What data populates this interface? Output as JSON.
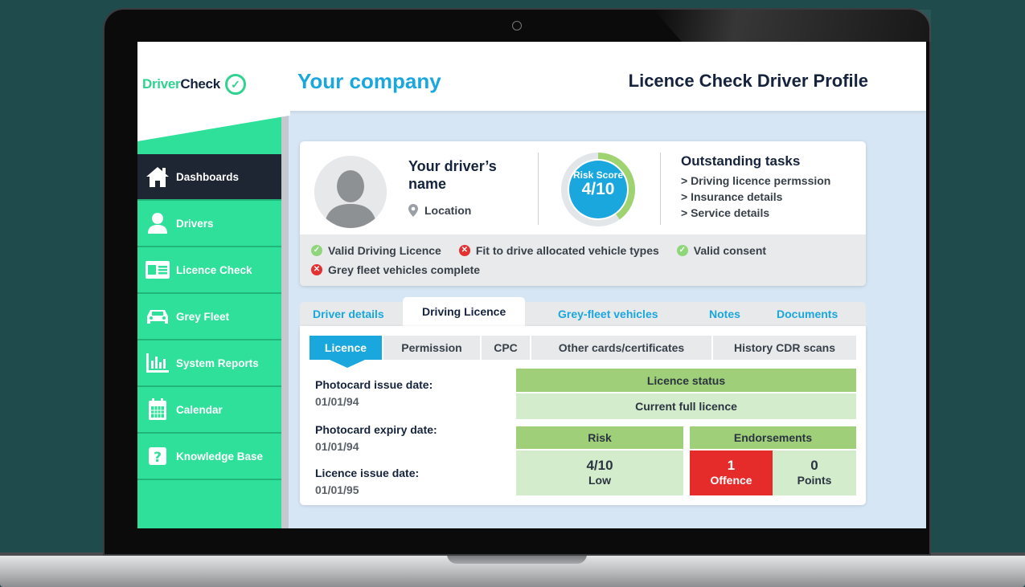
{
  "brand": {
    "logo_part1": "Driver",
    "logo_part2": "Check",
    "company": "Your company",
    "page_title": "Licence Check Driver Profile"
  },
  "sidebar": {
    "items": [
      {
        "label": "Dashboards",
        "icon": "home-icon",
        "active": true
      },
      {
        "label": "Drivers",
        "icon": "person-icon",
        "active": false
      },
      {
        "label": "Licence Check",
        "icon": "id-card-icon",
        "active": false
      },
      {
        "label": "Grey Fleet",
        "icon": "car-icon",
        "active": false
      },
      {
        "label": "System Reports",
        "icon": "bar-chart-icon",
        "active": false
      },
      {
        "label": "Calendar",
        "icon": "calendar-icon",
        "active": false
      },
      {
        "label": "Knowledge Base",
        "icon": "question-icon",
        "active": false
      }
    ]
  },
  "profile": {
    "driver_name": "Your driver’s name",
    "location": "Location",
    "risk_label": "Risk Score",
    "risk_score": "4/10",
    "risk_fraction": 0.4,
    "tasks_title": "Outstanding tasks",
    "tasks": [
      "> Driving licence permssion",
      "> Insurance details",
      "> Service details"
    ],
    "status": [
      {
        "label": "Valid Driving Licence",
        "ok": true
      },
      {
        "label": "Fit to drive allocated vehicle types",
        "ok": false
      },
      {
        "label": "Valid consent",
        "ok": true
      },
      {
        "label": "Grey fleet vehicles complete",
        "ok": false
      }
    ]
  },
  "tabs": {
    "items": [
      "Driver details",
      "Driving Licence",
      "Grey-fleet vehicles",
      "Notes",
      "Documents"
    ],
    "active": "Driving Licence"
  },
  "subtabs": {
    "items": [
      "Licence",
      "Permission",
      "CPC",
      "Other cards/certificates",
      "History CDR scans"
    ],
    "active": "Licence"
  },
  "licence": {
    "fields": [
      {
        "label": "Photocard issue date:",
        "value": "01/01/94"
      },
      {
        "label": "Photocard expiry date:",
        "value": "01/01/94"
      },
      {
        "label": "Licence issue date:",
        "value": "01/01/95"
      }
    ],
    "status_header": "Licence status",
    "status_value": "Current full licence",
    "risk_header": "Risk",
    "risk_value": "4/10",
    "risk_level": "Low",
    "endorsements_header": "Endorsements",
    "offence_count": "1",
    "offence_label": "Offence",
    "points_count": "0",
    "points_label": "Points"
  },
  "colors": {
    "green": "#2fe09a",
    "blue": "#1aa7dd",
    "navy": "#15233d",
    "red": "#e62b2b"
  }
}
